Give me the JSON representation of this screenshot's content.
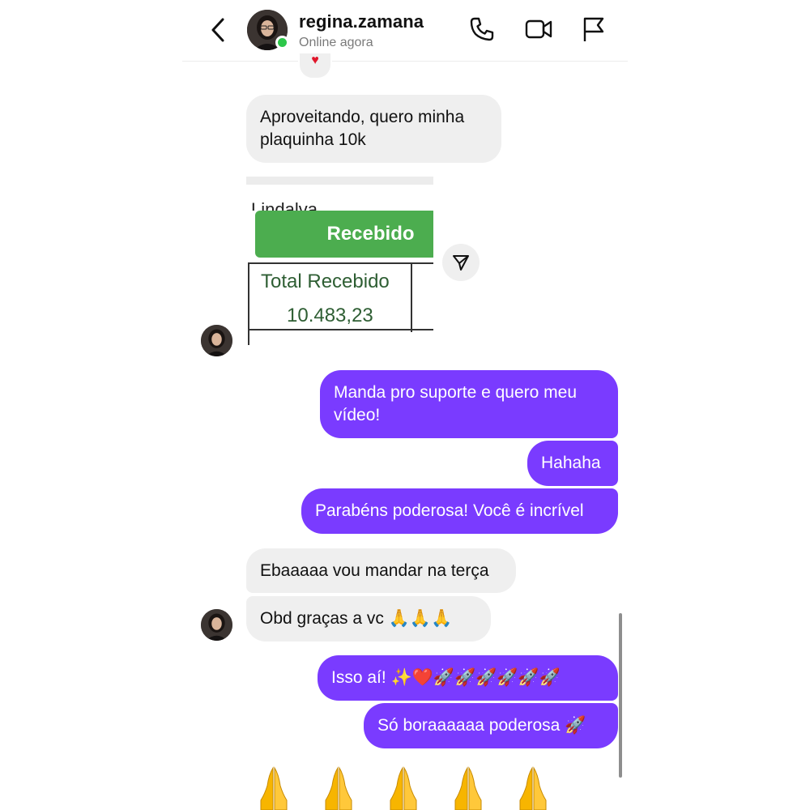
{
  "header": {
    "username": "regina.zamana",
    "status": "Online agora",
    "icons": [
      "back-chevron-icon",
      "phone-icon",
      "video-camera-icon",
      "flag-icon"
    ]
  },
  "reaction": {
    "emoji": "♥"
  },
  "messages": {
    "m1": "Aproveitando, quero minha plaquinha 10k",
    "m1_line1": "Aproveitando, quero minha",
    "m1_line2": "plaquinha 10k",
    "m2_line1": "Manda pro suporte e quero meu",
    "m2_line2": "vídeo!",
    "m3": "Hahaha",
    "m4": "Parabéns poderosa! Você é incrível",
    "m5": "Ebaaaaa vou mandar na terça",
    "m6": "Obd graças a vc 🙏🙏🙏",
    "m7": "Isso aí! ✨❤️🚀🚀🚀🚀🚀🚀",
    "m8": "Só boraaaaaa poderosa 🚀",
    "big_emoji": "🙏🙏🙏🙏🙏"
  },
  "shared_image": {
    "partial_text": "Lindalva",
    "button_label": "Recebido",
    "table_label": "Total Recebido",
    "table_value": "10.483,23"
  },
  "colors": {
    "outgoing_bubble": "#7a3bff",
    "incoming_bubble": "#efefef",
    "online_dot": "#2dc74a",
    "received_button": "#4cad4f"
  }
}
